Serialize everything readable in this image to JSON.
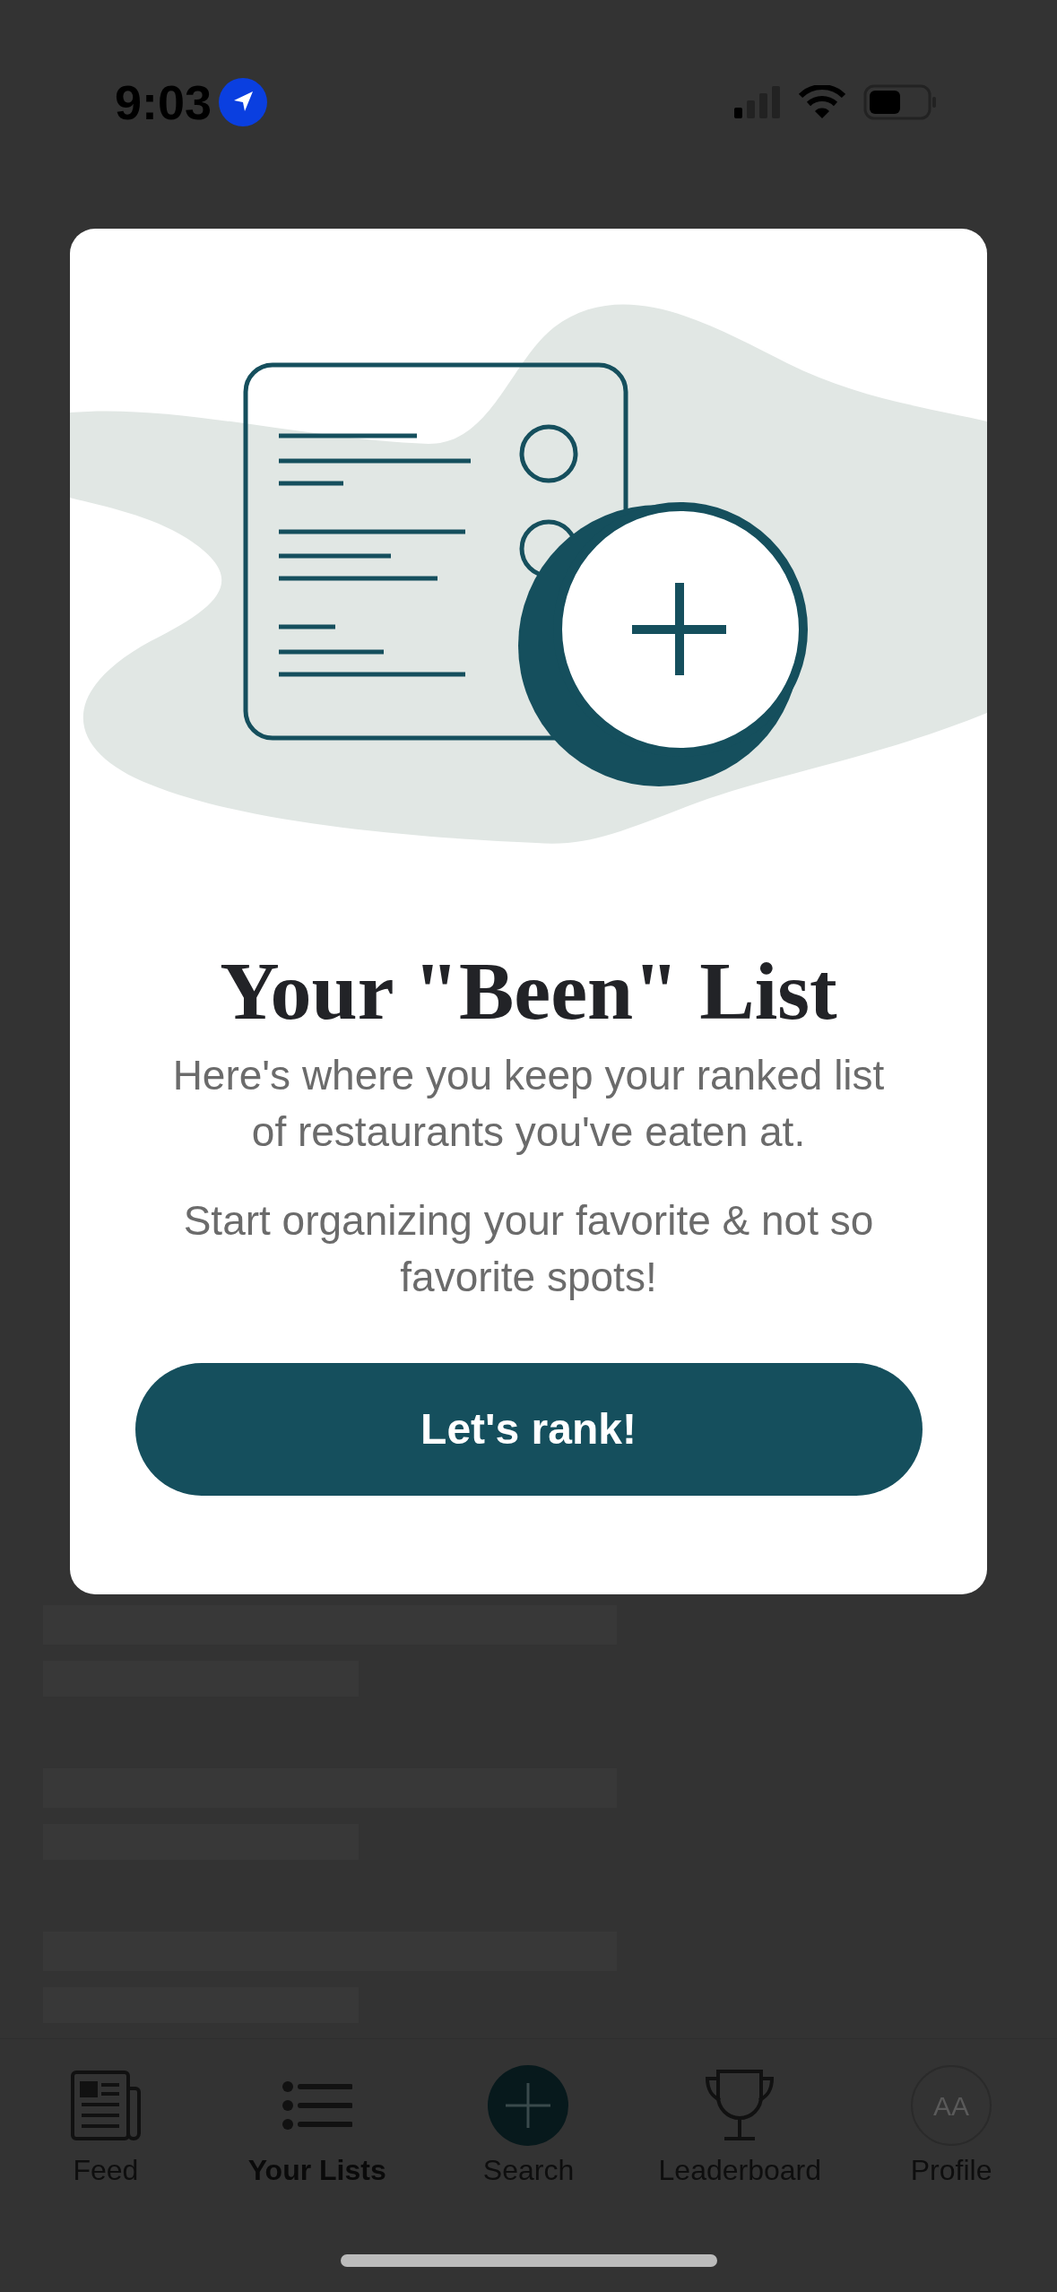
{
  "status_bar": {
    "time": "9:03"
  },
  "modal": {
    "title": "Your \"Been\" List",
    "paragraphs": [
      "Here's where you keep your ranked list of restaurants you've eaten at.",
      "Start organizing your favorite & not so favorite spots!"
    ],
    "button": "Let's rank!"
  },
  "tab_bar": [
    {
      "kind": "feed",
      "label": "Feed",
      "selected": false
    },
    {
      "kind": "lists",
      "label": "Your Lists",
      "selected": true
    },
    {
      "kind": "search",
      "label": "Search",
      "selected": false
    },
    {
      "kind": "trophy",
      "label": "Leaderboard",
      "selected": false
    },
    {
      "kind": "profile",
      "label": "Profile",
      "selected": false,
      "avatar": "AA"
    }
  ]
}
